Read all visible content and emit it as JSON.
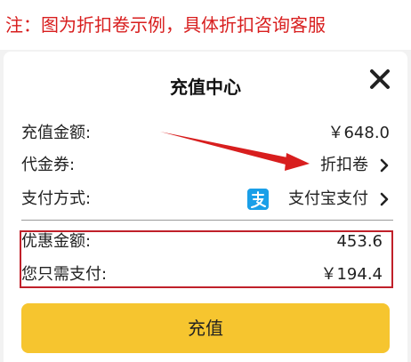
{
  "note": "注：图为折扣卷示例，具体折扣咨询客服",
  "dialog": {
    "title": "充值中心",
    "rows": {
      "amount": {
        "label": "充值金额:",
        "value": "￥648.0"
      },
      "voucher": {
        "label": "代金券:",
        "value": "折扣卷"
      },
      "payment": {
        "label": "支付方式:",
        "value": "支付宝支付"
      },
      "discount": {
        "label": "优惠金额:",
        "value": "453.6"
      },
      "pay": {
        "label": "您只需支付:",
        "value": "￥194.4"
      }
    },
    "button_label": "充值"
  },
  "colors": {
    "note_text": "#d81e1e",
    "button": "#f6c52f",
    "alipay": "#1a9fe8",
    "highlight": "#c0202a"
  },
  "icons": [
    "close-icon",
    "chevron-right-icon",
    "alipay-icon"
  ]
}
